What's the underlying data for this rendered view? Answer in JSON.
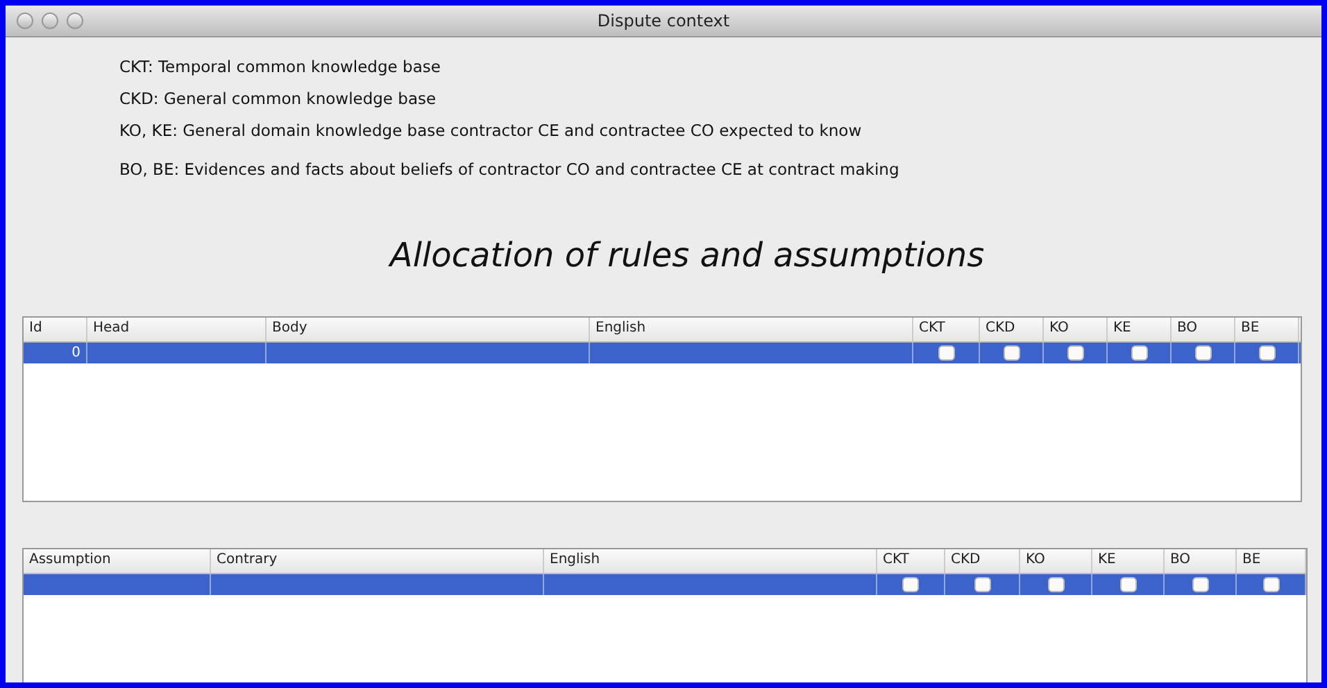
{
  "window": {
    "title": "Dispute context"
  },
  "legend": [
    "CKT: Temporal common knowledge base",
    "CKD: General common knowledge base",
    "KO, KE: General domain knowledge base contractor CE and contractee CO expected to know",
    "BO, BE: Evidences and facts about beliefs of contractor CO and contractee CE at contract making"
  ],
  "heading": "Allocation of rules and assumptions",
  "tables": [
    {
      "columns": [
        {
          "label": "Id",
          "kind": "number"
        },
        {
          "label": "Head",
          "kind": "text"
        },
        {
          "label": "Body",
          "kind": "text"
        },
        {
          "label": "English",
          "kind": "text"
        },
        {
          "label": "CKT",
          "kind": "check"
        },
        {
          "label": "CKD",
          "kind": "check"
        },
        {
          "label": "KO",
          "kind": "check"
        },
        {
          "label": "KE",
          "kind": "check"
        },
        {
          "label": "BO",
          "kind": "check"
        },
        {
          "label": "BE",
          "kind": "check"
        }
      ],
      "rows": [
        {
          "selected": true,
          "id": "0",
          "checked": [
            false,
            false,
            false,
            false,
            false,
            false
          ]
        }
      ]
    },
    {
      "columns": [
        {
          "label": "Assumption",
          "kind": "text"
        },
        {
          "label": "Contrary",
          "kind": "text"
        },
        {
          "label": "English",
          "kind": "text"
        },
        {
          "label": "CKT",
          "kind": "check"
        },
        {
          "label": "CKD",
          "kind": "check"
        },
        {
          "label": "KO",
          "kind": "check"
        },
        {
          "label": "KE",
          "kind": "check"
        },
        {
          "label": "BO",
          "kind": "check"
        },
        {
          "label": "BE",
          "kind": "check"
        }
      ],
      "rows": [
        {
          "selected": true,
          "checked": [
            false,
            false,
            false,
            false,
            false,
            false
          ]
        }
      ]
    }
  ]
}
